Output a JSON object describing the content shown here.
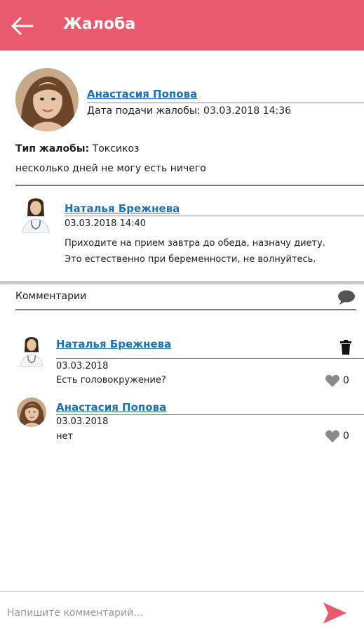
{
  "appbar": {
    "title": "Жалоба",
    "accent": "#ea5a6e"
  },
  "complaint": {
    "author_name": "Анастасия Попова",
    "date_text": "Дата подачи жалобы: 03.03.2018 14:36",
    "type_label": "Тип жалобы:",
    "type_value": "Токсикоз",
    "description": "несколько дней не могу есть ничего"
  },
  "reply": {
    "author_name": "Наталья Брежнева",
    "datetime": "03.03.2018 14:40",
    "line1": "Приходите на прием завтра до обеда, назначу диету.",
    "line2": "Это естественно при беременности, не волнуйтесь."
  },
  "comments_section": {
    "title": "Комментарии",
    "icon": "comment-bubble-icon"
  },
  "comments": [
    {
      "author": "Наталья Брежнева",
      "date": "03.03.2018",
      "text": "Есть головокружение?",
      "likes": "0",
      "deletable": true
    },
    {
      "author": "Анастасия Попова",
      "date": "03.03.2018",
      "text": "нет",
      "likes": "0",
      "deletable": false
    }
  ],
  "composer": {
    "placeholder": "Напишите комментарий...",
    "send_icon": "send-icon"
  }
}
